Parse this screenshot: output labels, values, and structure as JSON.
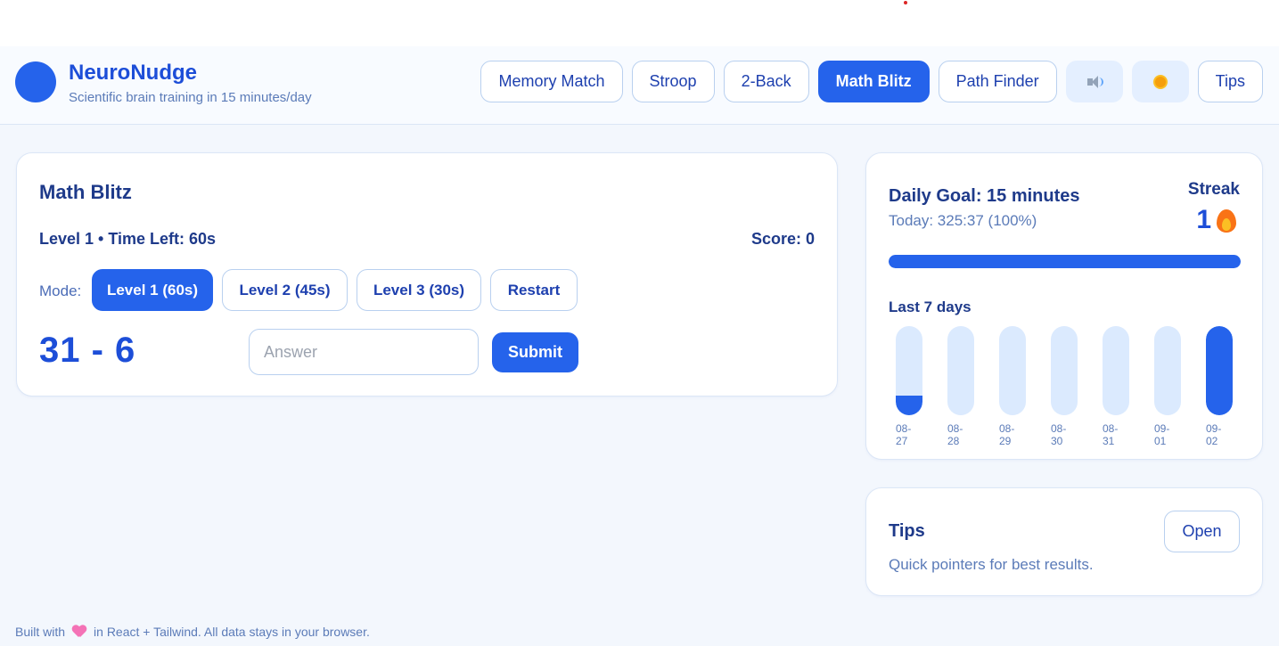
{
  "app": {
    "title": "NeuroNudge",
    "subtitle": "Scientific brain training in 15 minutes/day"
  },
  "nav": {
    "memory_match": "Memory Match",
    "stroop": "Stroop",
    "two_back": "2-Back",
    "math_blitz": "Math Blitz",
    "path_finder": "Path Finder",
    "sound_icon": "speaker-icon",
    "theme_icon": "sun-icon",
    "tips": "Tips",
    "active": "Math Blitz"
  },
  "game": {
    "title": "Math Blitz",
    "level_info": "Level 1 • Time Left: 60s",
    "score": "Score: 0",
    "mode_label": "Mode:",
    "modes": [
      "Level 1 (60s)",
      "Level 2 (45s)",
      "Level 3 (30s)"
    ],
    "restart": "Restart",
    "problem": "31 - 6",
    "answer_placeholder": "Answer",
    "submit": "Submit"
  },
  "goal": {
    "title": "Daily Goal: 15 minutes",
    "today": "Today: 325:37 (100%)",
    "progress_fraction": 1.0,
    "streak_label": "Streak",
    "streak_value": "1",
    "last7_label": "Last 7 days",
    "days": [
      {
        "label": "08-27",
        "fraction": 0.22
      },
      {
        "label": "08-28",
        "fraction": 0
      },
      {
        "label": "08-29",
        "fraction": 0
      },
      {
        "label": "08-30",
        "fraction": 0
      },
      {
        "label": "08-31",
        "fraction": 0
      },
      {
        "label": "09-01",
        "fraction": 0
      },
      {
        "label": "09-02",
        "fraction": 1.0
      }
    ]
  },
  "tips": {
    "title": "Tips",
    "description": "Quick pointers for best results.",
    "open": "Open"
  },
  "footer": {
    "before": "Built with",
    "after": "in React + Tailwind. All data stays in your browser."
  },
  "colors": {
    "accent": "#2563eb",
    "bar_track": "#dbeafe"
  }
}
